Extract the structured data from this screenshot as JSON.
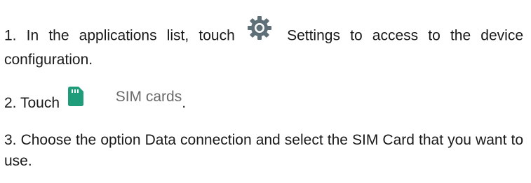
{
  "colors": {
    "text": "#1a1a1a",
    "settings_icon": "#5f6f78",
    "sim_icon": "#1f9d7a",
    "sim_label": "#6a6a6a"
  },
  "steps": [
    {
      "before": "1. In the applications list, touch",
      "icon": "settings-gear-icon",
      "after": "Settings to access to the device configuration."
    },
    {
      "before": "2. Touch",
      "icon": "sim-card-icon",
      "label": "SIM cards",
      "after": "."
    },
    {
      "text": "3. Choose the option Data connection and select the SIM Card that you want to use."
    }
  ]
}
